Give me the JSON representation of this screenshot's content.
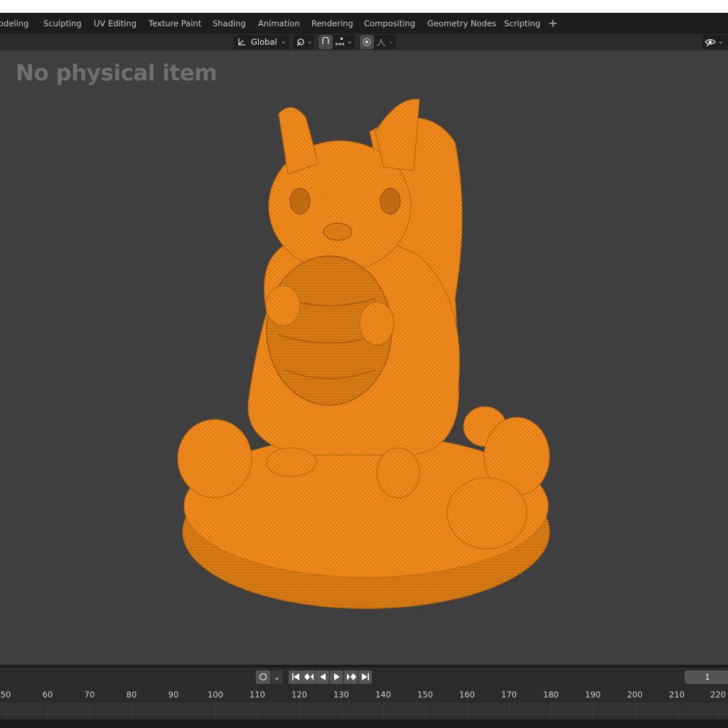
{
  "workspace_tabs": [
    "odeling",
    "Sculpting",
    "UV Editing",
    "Texture Paint",
    "Shading",
    "Animation",
    "Rendering",
    "Compositing",
    "Geometry Nodes",
    "Scripting"
  ],
  "add_tab_label": "+",
  "header": {
    "transform_orientation": "Global",
    "transform_icon": "axes-icon",
    "pivot_icon": "pivot-icon",
    "snap_icon": "magnet-icon",
    "snap_target_icon": "snap-increment-icon",
    "proportional_icon": "proportional-edit-icon",
    "falloff_icon": "falloff-curve-icon",
    "visibility_icon": "eye-icon"
  },
  "viewport": {
    "overlay_text": "No physical item",
    "model_color": "#f28c1c"
  },
  "timeline": {
    "current_frame": "1",
    "record_icon": "record-icon",
    "playback_icons": [
      "jump-start-icon",
      "prev-keyframe-icon",
      "play-reverse-icon",
      "play-icon",
      "next-keyframe-icon",
      "jump-end-icon"
    ],
    "ruler_labels": [
      "50",
      "60",
      "70",
      "80",
      "90",
      "100",
      "110",
      "120",
      "130",
      "140",
      "150",
      "160",
      "170",
      "180",
      "190",
      "200",
      "210",
      "220"
    ]
  }
}
